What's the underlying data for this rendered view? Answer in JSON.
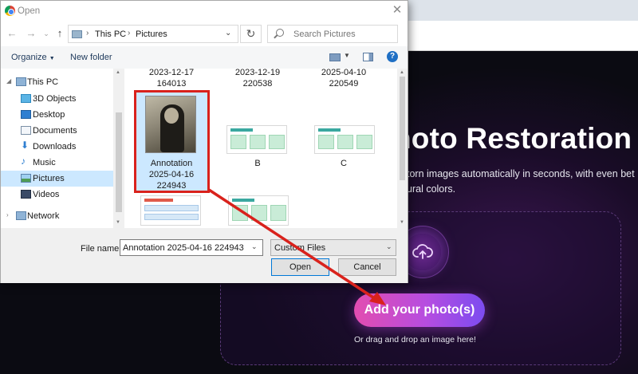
{
  "dialog": {
    "title": "Open",
    "breadcrumb": [
      "This PC",
      "Pictures"
    ],
    "search_placeholder": "Search Pictures",
    "toolbar": {
      "organize": "Organize",
      "new_folder": "New folder"
    },
    "tree": [
      {
        "label": "This PC",
        "icon": "computer-icon"
      },
      {
        "label": "3D Objects",
        "icon": "cube-icon"
      },
      {
        "label": "Desktop",
        "icon": "desktop-icon"
      },
      {
        "label": "Documents",
        "icon": "documents-icon"
      },
      {
        "label": "Downloads",
        "icon": "download-arrow-icon"
      },
      {
        "label": "Music",
        "icon": "music-note-icon"
      },
      {
        "label": "Pictures",
        "icon": "pictures-icon",
        "selected": true
      },
      {
        "label": "Videos",
        "icon": "videos-icon"
      },
      {
        "label": "Network",
        "icon": "network-icon"
      }
    ],
    "files": [
      {
        "line1": "2023-12-17",
        "line2": "164013"
      },
      {
        "line1": "2023-12-19",
        "line2": "220538"
      },
      {
        "line1": "2025-04-10",
        "line2": "220549"
      },
      {
        "line1": "Annotation",
        "line2": "2025-04-16",
        "line3": "224943",
        "selected": true
      },
      {
        "line1": "B"
      },
      {
        "line1": "C"
      }
    ],
    "file_name_label": "File name:",
    "file_name_value": "Annotation 2025-04-16 224943",
    "file_type": "Custom Files",
    "open_label": "Open",
    "cancel_label": "Cancel"
  },
  "page": {
    "hero_title": "hoto Restoration",
    "hero_sub_1": "torn images automatically in seconds, with even bet",
    "hero_sub_2": "ural colors.",
    "upload_button": "Add your photo(s)",
    "drag_hint": "Or drag and drop an image here!"
  },
  "colors": {
    "annotation_red": "#d9221c",
    "selection_blue": "#cce8ff",
    "cta_gradient_start": "#e24db0",
    "cta_gradient_end": "#7c4cf0"
  }
}
